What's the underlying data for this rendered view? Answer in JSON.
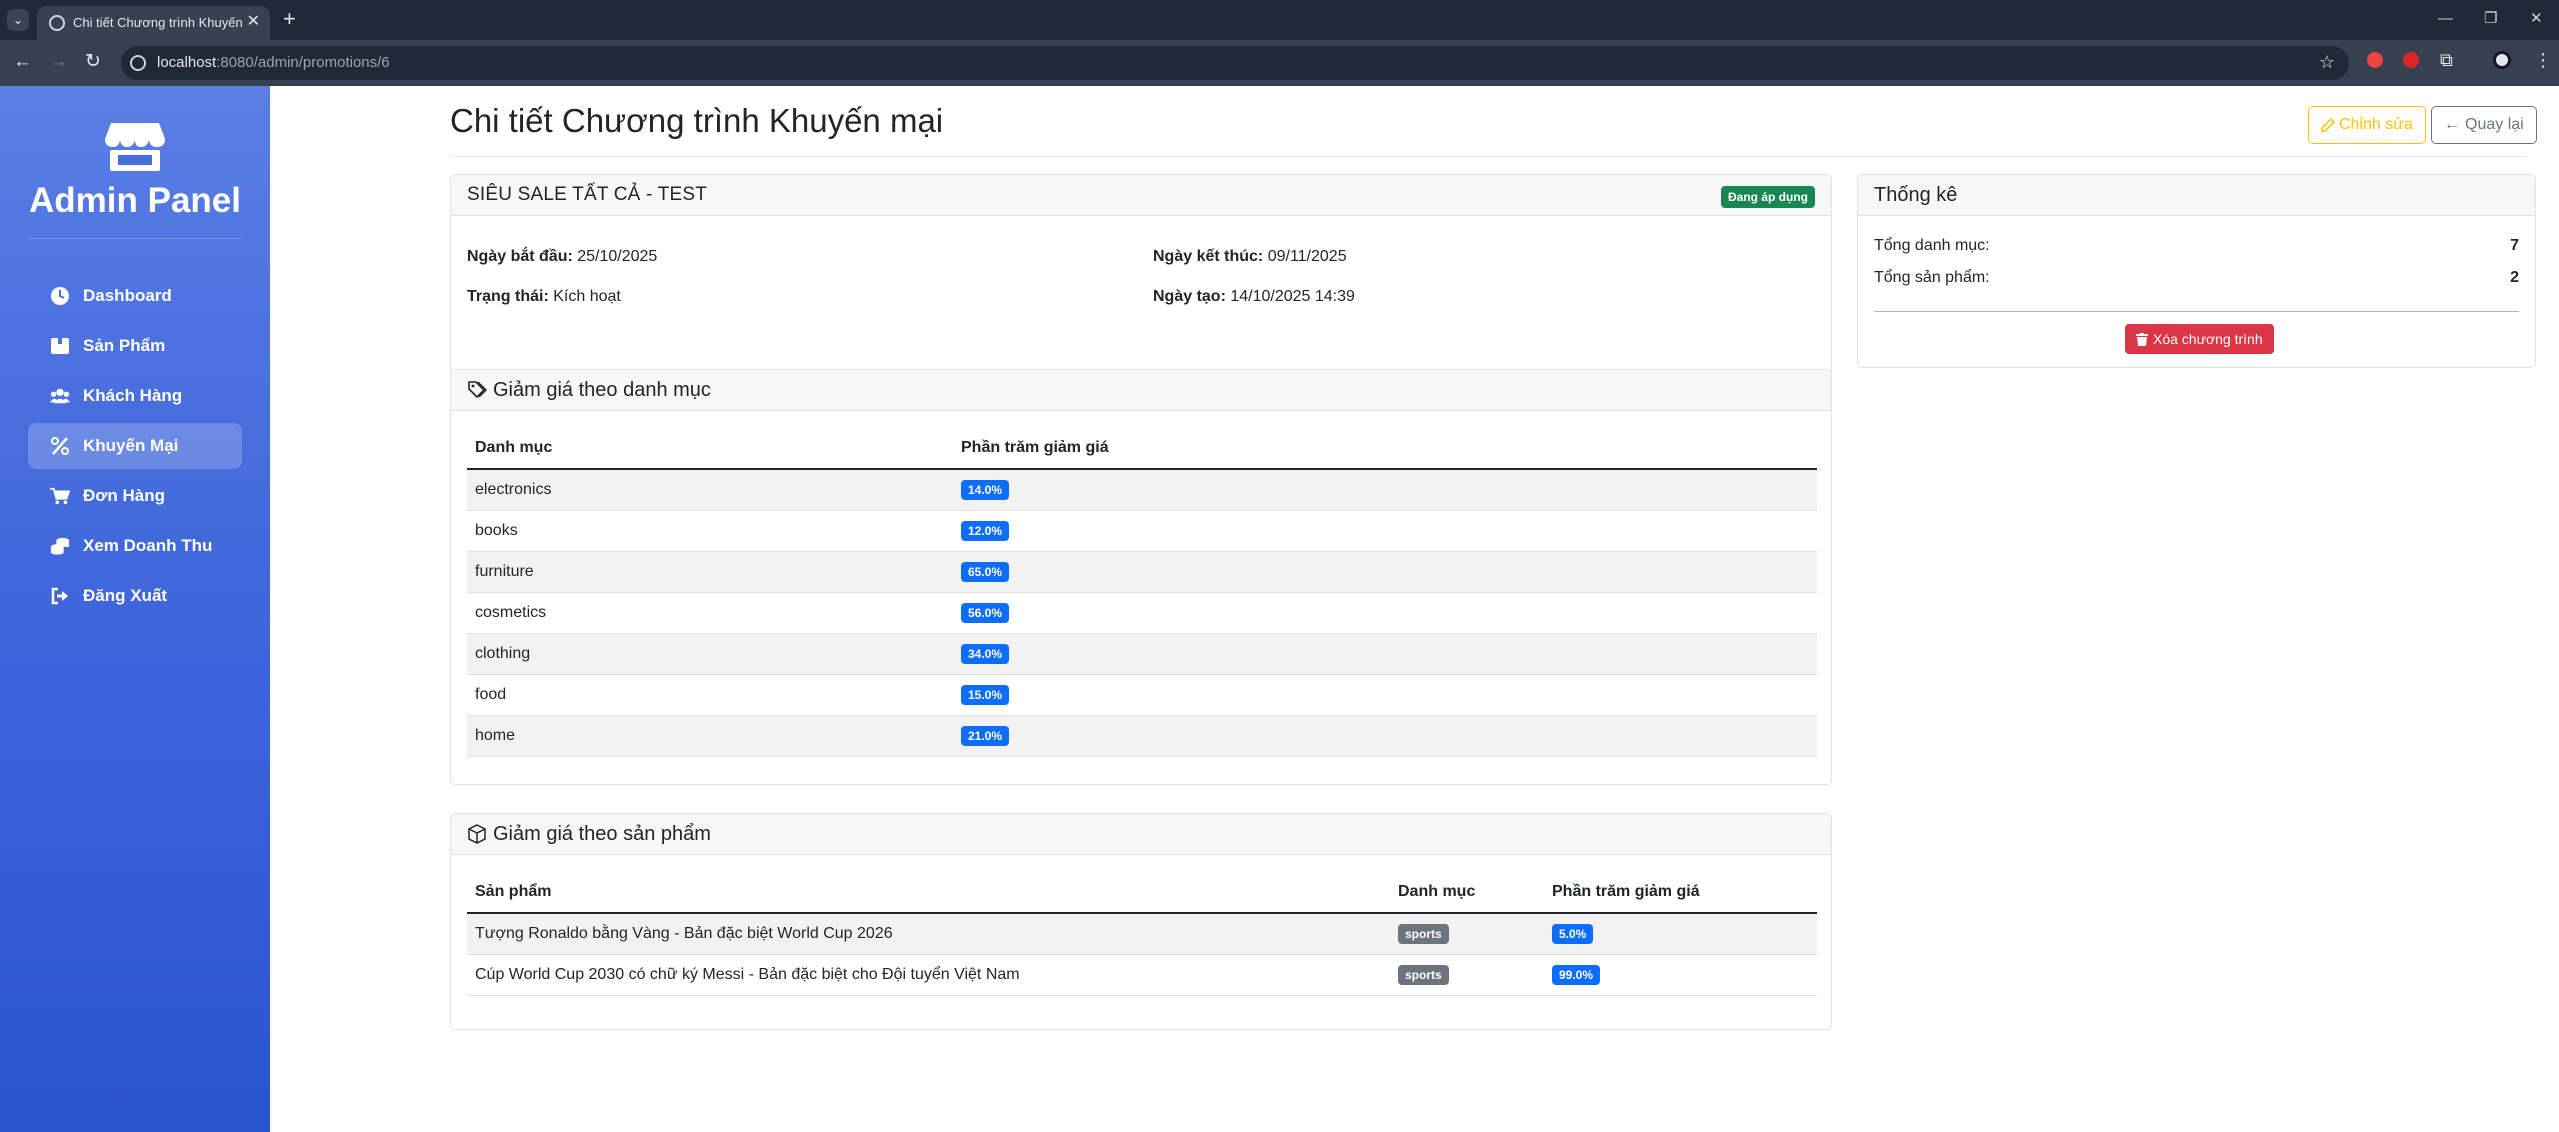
{
  "browser": {
    "tab_title": "Chi tiết Chương trình Khuyến m",
    "url_host": "localhost",
    "url_path": ":8080/admin/promotions/6"
  },
  "sidebar": {
    "brand": "Admin Panel",
    "brand_icon": "store-icon",
    "items": [
      {
        "label": "Dashboard",
        "icon": "clock-icon"
      },
      {
        "label": "Sản Phẩm",
        "icon": "box-icon"
      },
      {
        "label": "Khách Hàng",
        "icon": "users-icon"
      },
      {
        "label": "Khuyến Mại",
        "icon": "percent-icon",
        "active": true
      },
      {
        "label": "Đơn Hàng",
        "icon": "cart-icon"
      },
      {
        "label": "Xem Doanh Thu",
        "icon": "coins-icon"
      },
      {
        "label": "Đăng Xuất",
        "icon": "logout-icon"
      }
    ]
  },
  "header": {
    "title": "Chi tiết Chương trình Khuyến mại",
    "edit_label": "Chỉnh sửa",
    "back_label": "Quay lại"
  },
  "promotion": {
    "name": "SIÊU SALE TẤT CẢ - TEST",
    "status_badge": "Đang áp dụng",
    "start_label": "Ngày bắt đầu:",
    "start_value": "25/10/2025",
    "end_label": "Ngày kết thúc:",
    "end_value": "09/11/2025",
    "state_label": "Trạng thái:",
    "state_value": "Kích hoạt",
    "created_label": "Ngày tạo:",
    "created_value": "14/10/2025 14:39"
  },
  "category_discounts": {
    "title": "Giảm giá theo danh mục",
    "columns": [
      "Danh mục",
      "Phần trăm giảm giá"
    ],
    "rows": [
      {
        "category": "electronics",
        "percent": "14.0%"
      },
      {
        "category": "books",
        "percent": "12.0%"
      },
      {
        "category": "furniture",
        "percent": "65.0%"
      },
      {
        "category": "cosmetics",
        "percent": "56.0%"
      },
      {
        "category": "clothing",
        "percent": "34.0%"
      },
      {
        "category": "food",
        "percent": "15.0%"
      },
      {
        "category": "home",
        "percent": "21.0%"
      }
    ]
  },
  "product_discounts": {
    "title": "Giảm giá theo sản phẩm",
    "columns": [
      "Sản phẩm",
      "Danh mục",
      "Phần trăm giảm giá"
    ],
    "rows": [
      {
        "product": "Tượng Ronaldo bằng Vàng - Bản đặc biệt World Cup 2026",
        "category": "sports",
        "percent": "5.0%"
      },
      {
        "product": "Cúp World Cup 2030 có chữ ký Messi - Bản đặc biệt cho Đội tuyển Việt Nam",
        "category": "sports",
        "percent": "99.0%"
      }
    ]
  },
  "stats": {
    "title": "Thống kê",
    "total_categories_label": "Tổng danh mục:",
    "total_categories_value": "7",
    "total_products_label": "Tổng sản phẩm:",
    "total_products_value": "2",
    "delete_label": "Xóa chương trình"
  },
  "colors": {
    "sidebar_top": "#5b7ee5",
    "sidebar_bottom": "#2a53d0",
    "primary": "#0d6efd",
    "success": "#198754",
    "warning": "#ffc107",
    "danger": "#dc3545",
    "secondary": "#6c757d"
  }
}
